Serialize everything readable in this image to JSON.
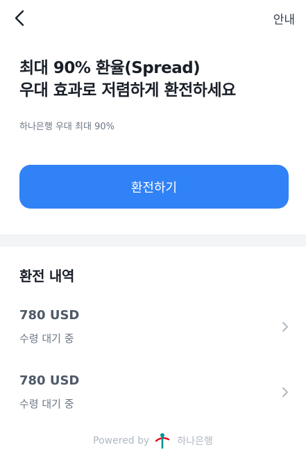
{
  "nav": {
    "back_icon": "chevron-left-icon",
    "info_label": "안내"
  },
  "hero": {
    "title_line1": "최대 90% 환율(Spread)",
    "title_line2": "우대 효과로 저렴하게 환전하세요",
    "subtitle": "하나은행 우대 최대 90%"
  },
  "primary_button": {
    "label": "환전하기",
    "color": "#3182f6"
  },
  "history": {
    "title": "환전 내역",
    "items": [
      {
        "amount": "780 USD",
        "status": "수령 대기 중"
      },
      {
        "amount": "780 USD",
        "status": "수령 대기 중"
      }
    ]
  },
  "footer": {
    "powered_by": "Powered by",
    "bank_name": "하나은행",
    "logo_icon": "hana-bank-logo-icon",
    "logo_color": "#009490"
  }
}
